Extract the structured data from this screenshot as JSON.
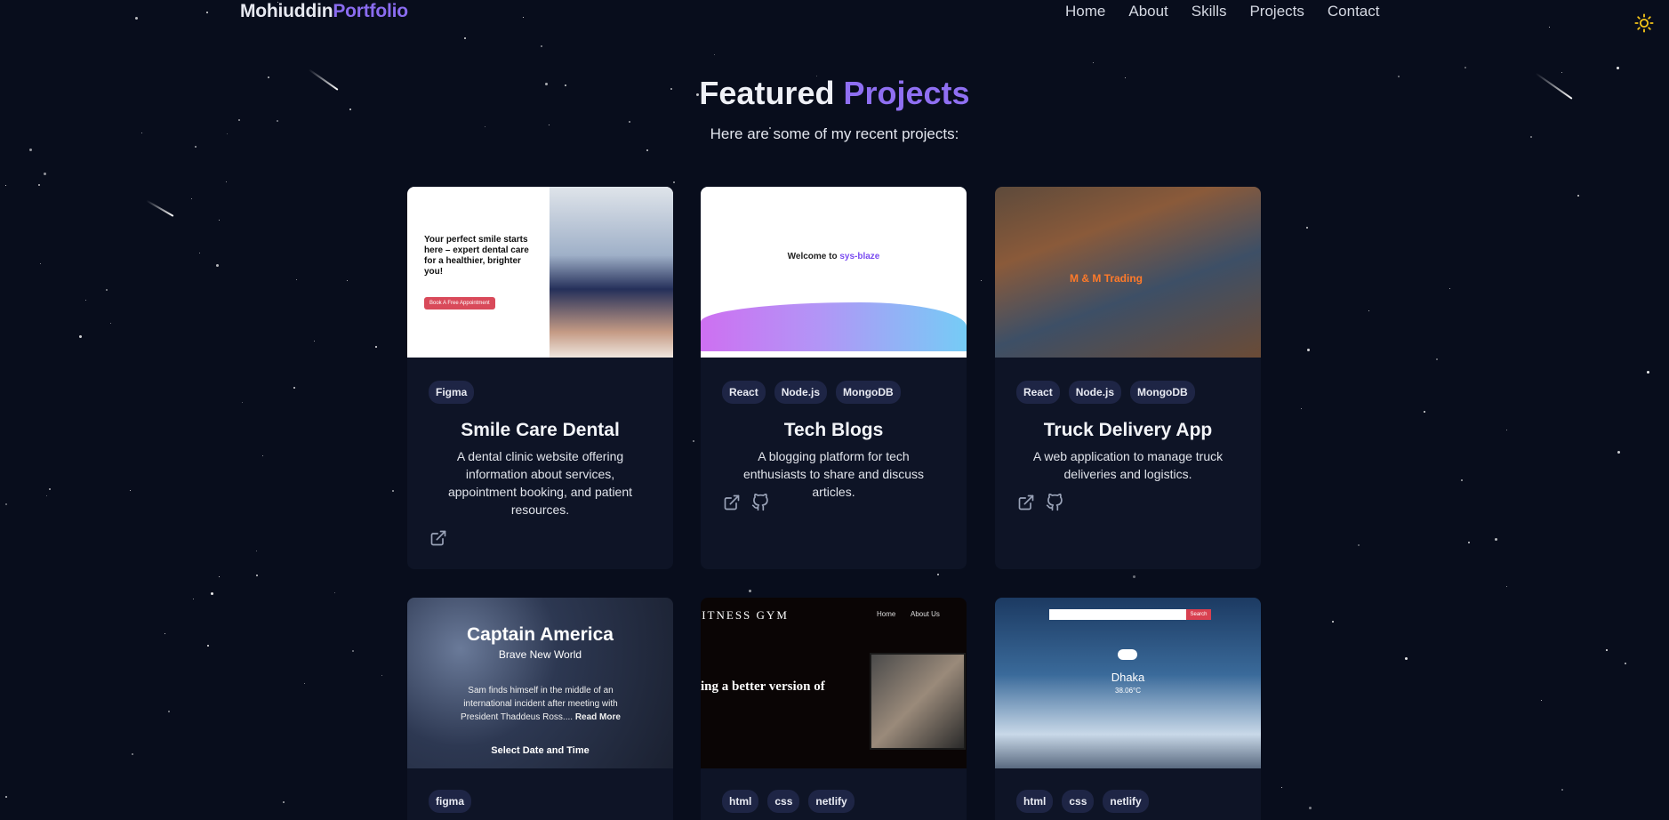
{
  "header": {
    "logo_part1": "Mohiuddin",
    "logo_part2": "Portfolio",
    "nav": [
      "Home",
      "About",
      "Skills",
      "Projects",
      "Contact"
    ],
    "theme_icon": "sun-icon"
  },
  "section": {
    "title_part1": "Featured",
    "title_part2": "Projects",
    "subtitle": "Here are some of my recent projects:"
  },
  "colors": {
    "background": "#080d1c",
    "accent": "#8a6cf0",
    "card": "#0e1426",
    "tag": "#1e2545",
    "sun": "#f5c518"
  },
  "projects": [
    {
      "tags": [
        "Figma"
      ],
      "title": "Smile Care Dental",
      "description": "A dental clinic website offering information about services, appointment booking, and patient resources.",
      "links": [
        "external-link-icon"
      ],
      "thumb": {
        "headline": "Your perfect smile starts here – expert dental care for a healthier, brighter you!",
        "button": "Book A Free Appointment"
      }
    },
    {
      "tags": [
        "React",
        "Node.js",
        "MongoDB"
      ],
      "title": "Tech Blogs",
      "description": "A blogging platform for tech enthusiasts to share and discuss articles.",
      "links": [
        "external-link-icon",
        "github-icon"
      ],
      "thumb": {
        "welcome": "Welcome to ",
        "brand": "sys-blaze"
      }
    },
    {
      "tags": [
        "React",
        "Node.js",
        "MongoDB"
      ],
      "title": "Truck Delivery App",
      "description": "A web application to manage truck deliveries and logistics.",
      "links": [
        "external-link-icon",
        "github-icon"
      ],
      "thumb": {
        "brand": "M & M Trading"
      }
    },
    {
      "tags": [
        "figma"
      ],
      "title": "",
      "description": "",
      "links": [],
      "thumb": {
        "headline": "Captain America",
        "sub": "Brave New World",
        "text": "Sam finds himself in the middle of an international incident after meeting with President Thaddeus Ross....",
        "read_more": "Read More",
        "cta": "Select Date and Time"
      }
    },
    {
      "tags": [
        "html",
        "css",
        "netlify"
      ],
      "title": "",
      "description": "",
      "links": [],
      "thumb": {
        "brand": "FITNESS GYM",
        "nav1": "Home",
        "nav2": "About Us",
        "headline": "ing a better version of"
      }
    },
    {
      "tags": [
        "html",
        "css",
        "netlify"
      ],
      "title": "",
      "description": "",
      "links": [],
      "thumb": {
        "city": "Dhaka",
        "temp": "38.06°C",
        "search": "Search"
      }
    }
  ]
}
